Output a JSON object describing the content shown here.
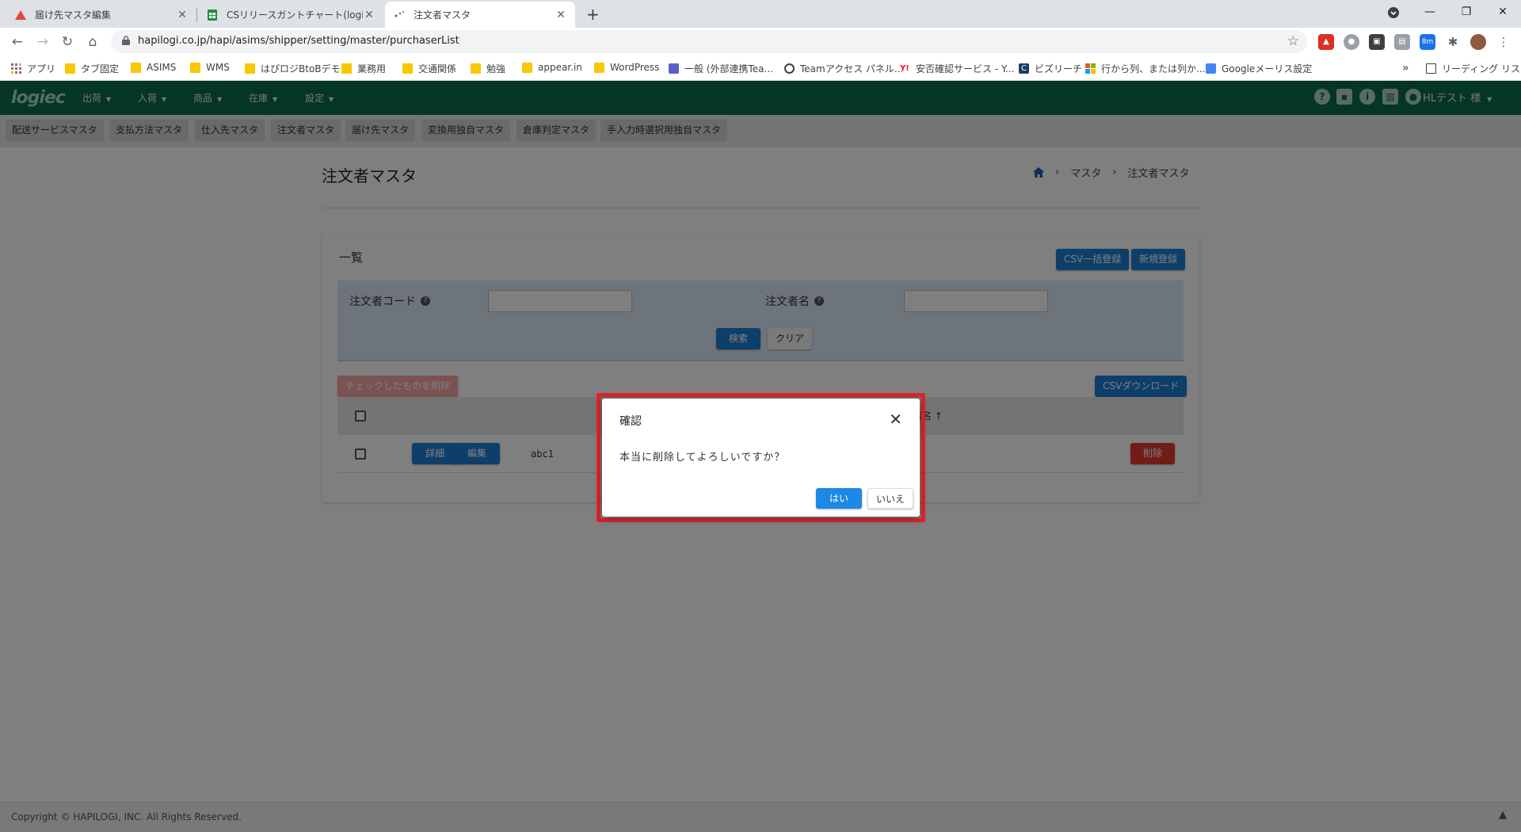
{
  "browser": {
    "tabs": [
      {
        "title": "届け先マスタ編集"
      },
      {
        "title": "CSリリースガントチャート(logiec) - Go"
      },
      {
        "title": "注文者マスタ"
      }
    ],
    "new_tab": "+",
    "url": "hapilogi.co.jp/hapi/asims/shipper/setting/master/purchaserList",
    "extension_badge": "8m",
    "bookmarks": [
      {
        "label": "アプリ",
        "icon": "apps-grid-icon"
      },
      {
        "label": "タブ固定",
        "icon": "folder-icon"
      },
      {
        "label": "ASIMS",
        "icon": "folder-icon"
      },
      {
        "label": "WMS",
        "icon": "folder-icon"
      },
      {
        "label": "はぴロジBtoBデモ",
        "icon": "folder-icon"
      },
      {
        "label": "業務用",
        "icon": "folder-icon"
      },
      {
        "label": "交通関係",
        "icon": "folder-icon"
      },
      {
        "label": "勉強",
        "icon": "folder-icon"
      },
      {
        "label": "appear.in",
        "icon": "folder-icon"
      },
      {
        "label": "WordPress",
        "icon": "folder-icon"
      },
      {
        "label": "一般 (外部連携Tea...",
        "icon": "teams-icon"
      },
      {
        "label": "Teamアクセス パネル...",
        "icon": "globe-icon"
      },
      {
        "label": "安否確認サービス - Y...",
        "icon": "yahoo-icon"
      },
      {
        "label": "ビズリーチ",
        "icon": "bizreach-icon"
      },
      {
        "label": "行から列、または列か...",
        "icon": "microsoft-icon"
      },
      {
        "label": "Googleメーリス設定",
        "icon": "google-icon"
      }
    ],
    "more": "»",
    "reading_list": "リーディング リスト"
  },
  "app": {
    "logo": "logiec",
    "menu": [
      "出荷",
      "入荷",
      "商品",
      "在庫",
      "設定"
    ],
    "user": "HLテスト 様",
    "subtabs": [
      "配送サービスマスタ",
      "支払方法マスタ",
      "仕入先マスタ",
      "注文者マスタ",
      "届け先マスタ",
      "変換用独自マスタ",
      "倉庫判定マスタ",
      "手入力時選択用独自マスタ"
    ]
  },
  "page": {
    "title": "注文者マスタ",
    "breadcrumb": [
      "マスタ",
      "注文者マスタ"
    ],
    "list_title": "一覧",
    "csv_bulk_button": "CSV一括登録",
    "new_button": "新規登録",
    "search": {
      "code_label": "注文者コード",
      "name_label": "注文者名",
      "search_button": "検索",
      "clear_button": "クリア"
    },
    "delete_checked_button": "チェックしたものを削除",
    "csv_download_button": "CSVダウンロード",
    "table": {
      "name_header": "者名 ↑",
      "rows": [
        {
          "detail": "詳細",
          "edit": "編集",
          "code": "abc1",
          "delete": "削除"
        }
      ]
    }
  },
  "dialog": {
    "title": "確認",
    "message": "本当に削除してよろしいですか？",
    "yes": "はい",
    "no": "いいえ"
  },
  "footer": {
    "copyright": "Copyright © HAPILOGI, INC. All Rights Reserved."
  }
}
